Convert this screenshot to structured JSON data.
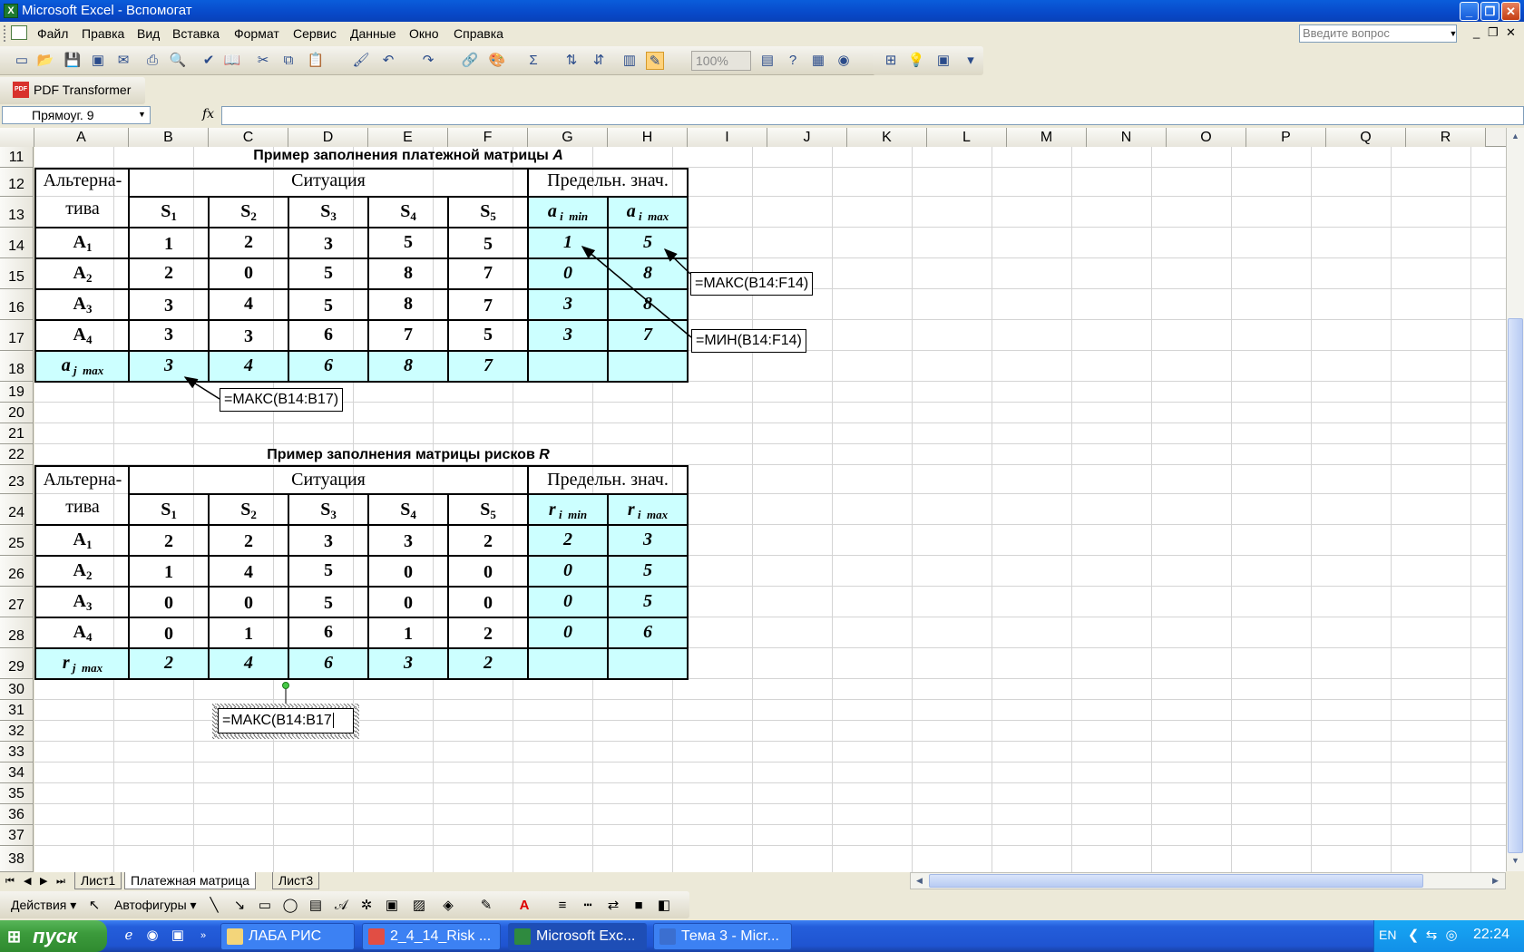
{
  "titlebar": {
    "app_icon": "X",
    "title": "Microsoft Excel - Вспомогат"
  },
  "menu": {
    "items": [
      "Файл",
      "Правка",
      "Вид",
      "Вставка",
      "Формат",
      "Сервис",
      "Данные",
      "Окно",
      "Справка"
    ],
    "help_placeholder": "Введите вопрос"
  },
  "toolbar": {
    "zoom": "100%"
  },
  "pdf_toolbar": {
    "icon_text": "PDF",
    "label": "PDF Transformer"
  },
  "formula_bar": {
    "name_box": "Прямоуг. 9",
    "fx": "fx",
    "formula": ""
  },
  "columns": [
    "A",
    "B",
    "C",
    "D",
    "E",
    "F",
    "G",
    "H",
    "I",
    "J",
    "K",
    "L",
    "M",
    "N",
    "O",
    "P",
    "Q",
    "R"
  ],
  "rows": [
    "11",
    "12",
    "13",
    "14",
    "15",
    "16",
    "17",
    "18",
    "19",
    "20",
    "21",
    "22",
    "23",
    "24",
    "25",
    "26",
    "27",
    "28",
    "29",
    "30",
    "31",
    "32",
    "33",
    "34",
    "35",
    "36",
    "37",
    "38"
  ],
  "matrix_a": {
    "title": "Пример заполнения платежной матрицы ",
    "title_letter": "A",
    "alt_header_1": "Альтерна-",
    "alt_header_2": "тива",
    "situation_header": "Ситуация",
    "limit_header": "Предельн. знач.",
    "s_labels": [
      "S1",
      "S2",
      "S3",
      "S4",
      "S5"
    ],
    "min_label": "a i min",
    "max_label": "a i max",
    "alternatives": [
      "A1",
      "A2",
      "A3",
      "A4"
    ],
    "values": [
      [
        1,
        2,
        3,
        5,
        5
      ],
      [
        2,
        0,
        5,
        8,
        7
      ],
      [
        3,
        4,
        5,
        8,
        7
      ],
      [
        3,
        3,
        6,
        7,
        5
      ]
    ],
    "mins": [
      1,
      0,
      3,
      3
    ],
    "maxs": [
      5,
      8,
      8,
      7
    ],
    "col_max_label": "a j max",
    "col_max": [
      3,
      4,
      6,
      8,
      7
    ]
  },
  "matrix_r": {
    "title": "Пример заполнения матрицы рисков ",
    "title_letter": "R",
    "alt_header_1": "Альтерна-",
    "alt_header_2": "тива",
    "situation_header": "Ситуация",
    "limit_header": "Предельн. знач.",
    "s_labels": [
      "S1",
      "S2",
      "S3",
      "S4",
      "S5"
    ],
    "min_label": "r i min",
    "max_label": "r i max",
    "alternatives": [
      "A1",
      "A2",
      "A3",
      "A4"
    ],
    "values": [
      [
        2,
        2,
        3,
        3,
        2
      ],
      [
        1,
        4,
        5,
        0,
        0
      ],
      [
        0,
        0,
        5,
        0,
        0
      ],
      [
        0,
        1,
        6,
        1,
        2
      ]
    ],
    "mins": [
      2,
      0,
      0,
      0
    ],
    "maxs": [
      3,
      5,
      5,
      6
    ],
    "col_max_label": "r j max",
    "col_max": [
      2,
      4,
      6,
      3,
      2
    ]
  },
  "callouts": {
    "max_row": "=МАКС(B14:F14)",
    "min_row": "=МИН(B14:F14)",
    "max_col": "=МАКС(B14:B17)",
    "editing": "=МАКС(B14:B17"
  },
  "sheet_tabs": [
    "Лист1",
    "Платежная матрица",
    "Лист3"
  ],
  "active_tab": "Платежная матрица",
  "draw_toolbar": {
    "actions": "Действия",
    "autoshapes": "Автофигуры"
  },
  "taskbar": {
    "start": "пуск",
    "tasks": [
      "ЛАБА РИС",
      "2_4_14_Risk ...",
      "Microsoft Exc...",
      "Тема 3 - Micr..."
    ],
    "active_task": "Microsoft Exc...",
    "lang": "EN",
    "clock": "22:24"
  },
  "colors": {
    "highlight_cells": "#ccffff",
    "title_bar": "#0a5ddb",
    "taskbar": "#245edb",
    "start": "#3c9b3c"
  }
}
